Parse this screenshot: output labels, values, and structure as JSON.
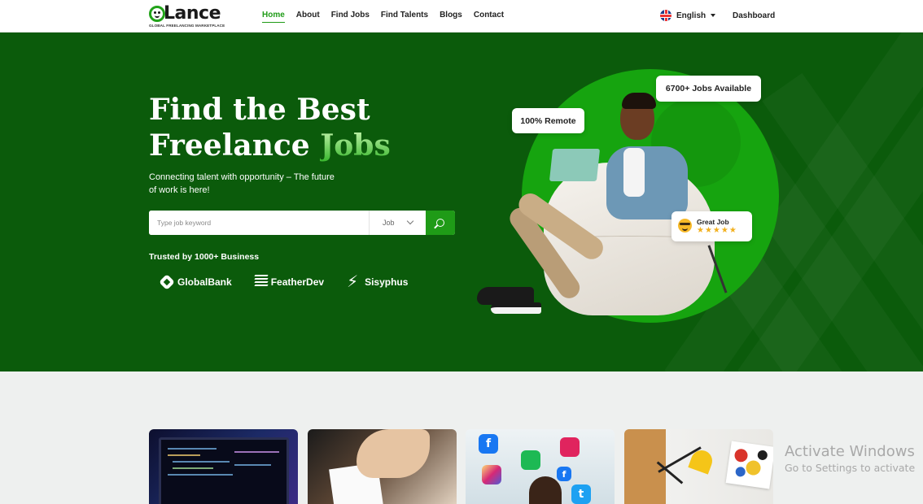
{
  "brand": {
    "name": "Lance",
    "tagline": "GLOBAL FREELANCING MARKETPLACE"
  },
  "nav": {
    "items": [
      {
        "label": "Home",
        "active": true
      },
      {
        "label": "About",
        "active": false
      },
      {
        "label": "Find Jobs",
        "active": false
      },
      {
        "label": "Find Talents",
        "active": false
      },
      {
        "label": "Blogs",
        "active": false
      },
      {
        "label": "Contact",
        "active": false
      }
    ],
    "language": "English",
    "dashboard": "Dashboard"
  },
  "hero": {
    "title_line1": "Find the Best",
    "title_line2_prefix": "Freelance ",
    "title_line2_highlight": "Jobs",
    "subtitle": "Connecting talent with opportunity – The future of work is here!",
    "search": {
      "placeholder": "Type job keyword",
      "category": "Job"
    },
    "trusted_label": "Trusted by 1000+ Business",
    "brands": [
      "GlobalBank",
      "FeatherDev",
      "Sisyphus"
    ],
    "badges": {
      "jobs": "6700+ Jobs Available",
      "remote": "100% Remote",
      "rating_label": "Great Job",
      "rating_stars": "★★★★★"
    }
  },
  "social_icons": [
    "f",
    "f",
    "t",
    "t"
  ],
  "watermark": {
    "title": "Activate Windows",
    "subtitle": "Go to Settings to activate"
  },
  "colors": {
    "primary": "#1f9b17",
    "hero_bg": "#0b5b0b",
    "circle": "#16a40f"
  }
}
